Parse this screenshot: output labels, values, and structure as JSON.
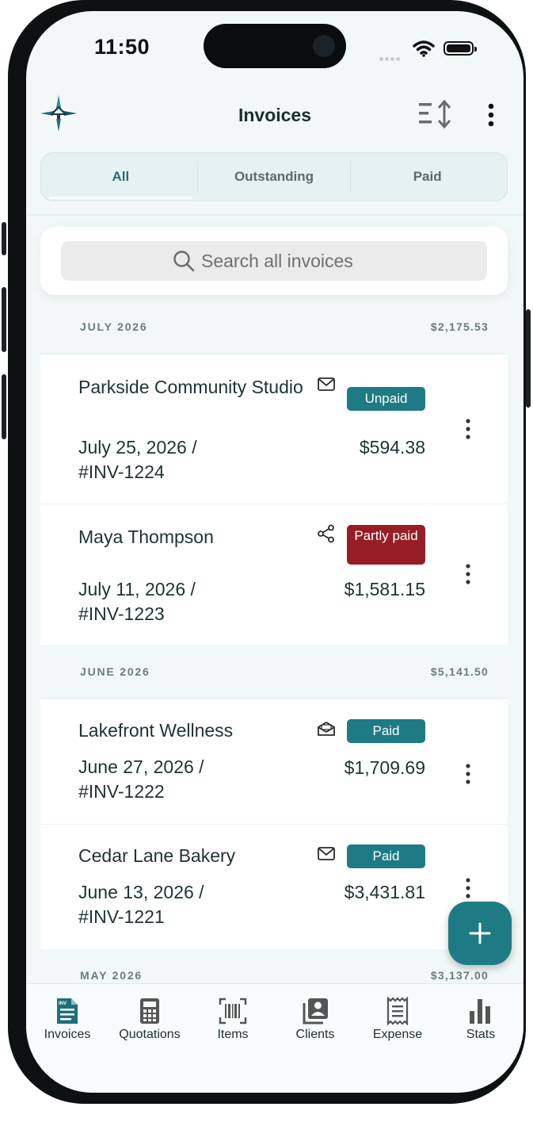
{
  "status_bar": {
    "time": "11:50"
  },
  "header": {
    "title": "Invoices"
  },
  "tabs": [
    {
      "label": "All",
      "active": true
    },
    {
      "label": "Outstanding",
      "active": false
    },
    {
      "label": "Paid",
      "active": false
    }
  ],
  "search": {
    "placeholder": "Search all invoices"
  },
  "sections": [
    {
      "month": "JULY 2026",
      "total": "$2,175.53",
      "invoices": [
        {
          "client": "Parkside Community Studio",
          "icon": "envelope-icon",
          "status": "Unpaid",
          "date_line": "July 25, 2026 /",
          "number": "#INV-1224",
          "amount": "$594.38"
        },
        {
          "client": "Maya Thompson",
          "icon": "share-icon",
          "status": "Partly paid",
          "date_line": "July 11, 2026 /",
          "number": "#INV-1223",
          "amount": "$1,581.15"
        }
      ]
    },
    {
      "month": "JUNE 2026",
      "total": "$5,141.50",
      "invoices": [
        {
          "client": "Lakefront Wellness",
          "icon": "envelope-open-icon",
          "status": "Paid",
          "date_line": "June 27, 2026 /",
          "number": "#INV-1222",
          "amount": "$1,709.69"
        },
        {
          "client": "Cedar Lane Bakery",
          "icon": "envelope-icon",
          "status": "Paid",
          "date_line": "June 13, 2026 /",
          "number": "#INV-1221",
          "amount": "$3,431.81"
        }
      ]
    },
    {
      "month": "MAY 2026",
      "total": "$3,137.00",
      "invoices": []
    }
  ],
  "colors": {
    "accent": "#1e7b85",
    "unpaid": "#1e7b85",
    "partly_paid": "#961d26",
    "paid": "#1e7b85"
  },
  "bottom_nav": [
    {
      "label": "Invoices",
      "icon": "invoice-doc-icon",
      "active": true
    },
    {
      "label": "Quotations",
      "icon": "calculator-icon",
      "active": false
    },
    {
      "label": "Items",
      "icon": "barcode-icon",
      "active": false
    },
    {
      "label": "Clients",
      "icon": "contacts-icon",
      "active": false
    },
    {
      "label": "Expense",
      "icon": "receipt-icon",
      "active": false
    },
    {
      "label": "Stats",
      "icon": "bar-chart-icon",
      "active": false
    }
  ],
  "fab": {
    "icon": "plus-icon"
  }
}
